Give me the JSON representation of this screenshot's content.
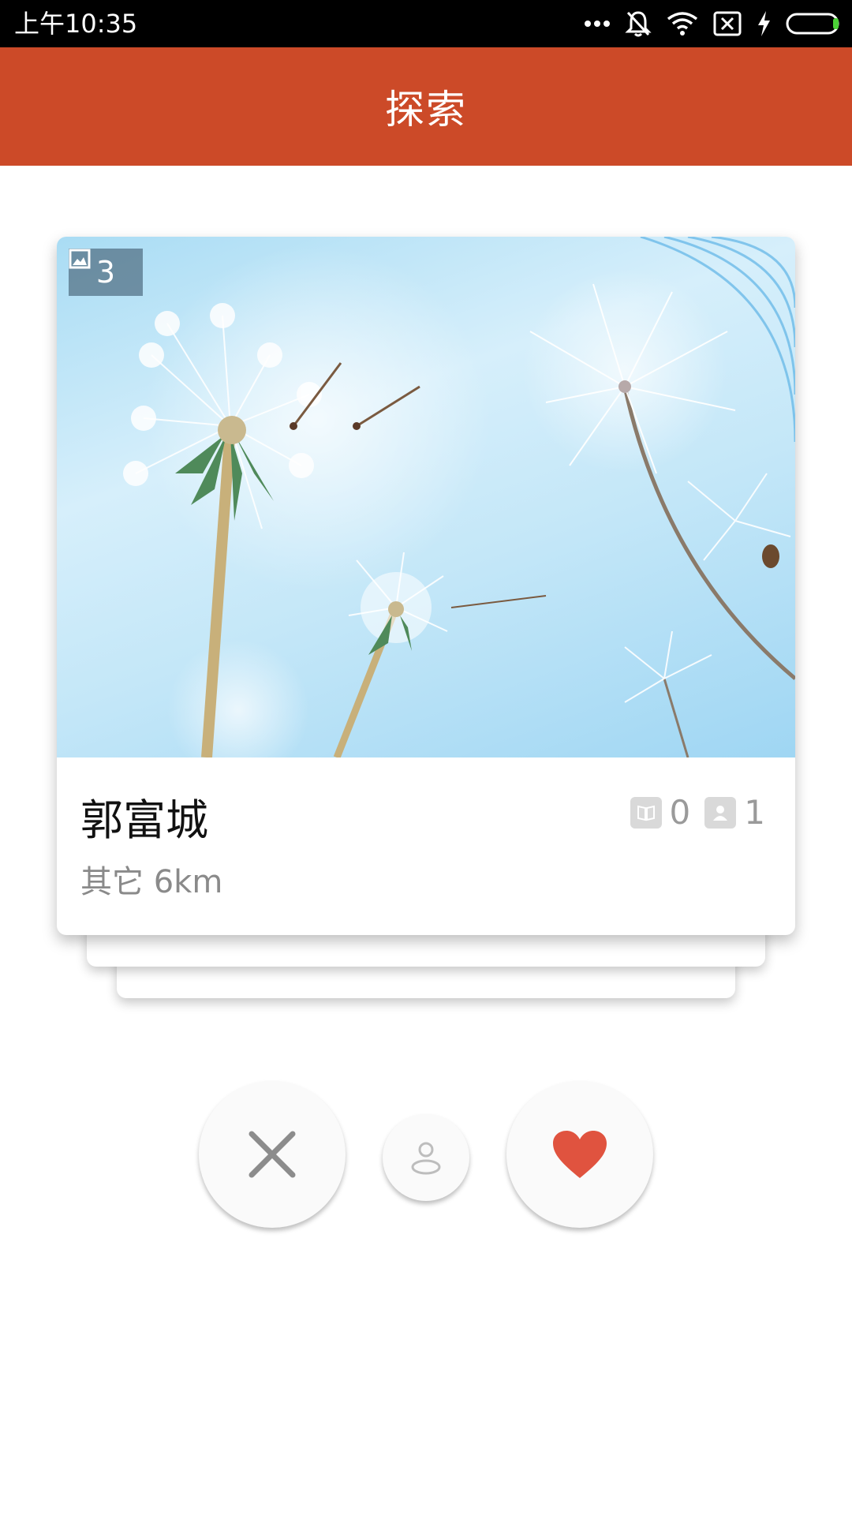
{
  "status_bar": {
    "time": "上午10:35",
    "icons": [
      "more-dots-icon",
      "bell-muted-icon",
      "wifi-icon",
      "no-sim-icon",
      "charging-bolt-icon",
      "battery-icon"
    ]
  },
  "app_bar": {
    "title": "探索"
  },
  "card": {
    "photo_count": "3",
    "name": "郭富城",
    "meta": "其它 6km",
    "stats": [
      {
        "icon": "book-icon",
        "value": "0"
      },
      {
        "icon": "person-icon",
        "value": "1"
      }
    ]
  },
  "actions": [
    {
      "name": "dislike-button",
      "icon": "close-icon"
    },
    {
      "name": "profile-button",
      "icon": "person-outline-icon"
    },
    {
      "name": "like-button",
      "icon": "heart-icon"
    }
  ],
  "colors": {
    "app_bar": "#cc4a28",
    "like": "#e0533f",
    "dislike": "#8c8c8c"
  }
}
